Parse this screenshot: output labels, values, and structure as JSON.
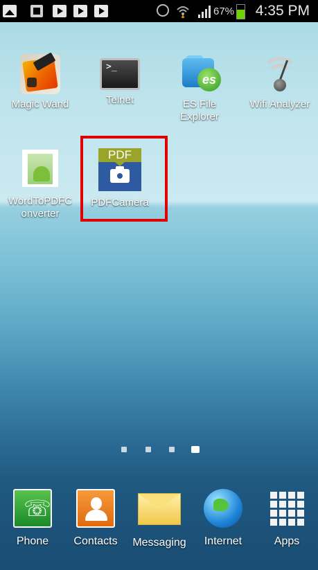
{
  "status_bar": {
    "battery_percent": "67%",
    "time": "4:35 PM",
    "icons": [
      "gallery-icon",
      "sd-card-icon",
      "play-icon",
      "play-icon",
      "play-icon",
      "alarm-icon",
      "wifi-icon",
      "signal-icon",
      "battery-icon"
    ],
    "battery_level": 0.67,
    "battery_color": "#6dd400"
  },
  "home": {
    "apps": [
      {
        "label": "Magic Wand",
        "icon": "magic-wand-icon"
      },
      {
        "label": "Telnet",
        "icon": "terminal-icon"
      },
      {
        "label": "ES File Explorer",
        "icon": "es-file-explorer-icon"
      },
      {
        "label": "Wifi Analyzer",
        "icon": "wifi-analyzer-icon"
      },
      {
        "label": "WordToPDFConverter",
        "label_line1": "WordToPDFC",
        "label_line2": "onverter",
        "icon": "word-to-pdf-icon"
      },
      {
        "label": "PDFCamera",
        "icon": "pdf-camera-icon",
        "icon_text": "PDF"
      }
    ],
    "highlight": {
      "target": "PDFCamera",
      "color": "#e00000"
    },
    "telnet_prompt": ">_",
    "es_badge": "es"
  },
  "page_indicator": {
    "total": 4,
    "active_index": 3
  },
  "dock": [
    {
      "label": "Phone",
      "icon": "phone-icon",
      "glyph": "☏"
    },
    {
      "label": "Contacts",
      "icon": "contacts-icon"
    },
    {
      "label": "Messaging",
      "icon": "envelope-icon"
    },
    {
      "label": "Internet",
      "icon": "globe-icon"
    },
    {
      "label": "Apps",
      "icon": "app-grid-icon"
    }
  ]
}
